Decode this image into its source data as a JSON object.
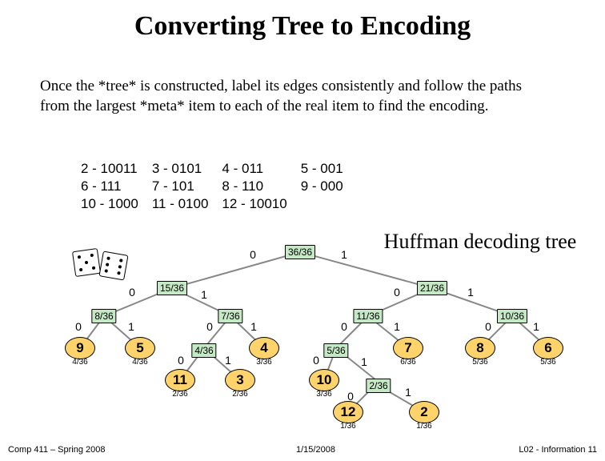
{
  "title": "Converting Tree to Encoding",
  "body": "Once the *tree* is constructed, label its edges consistently and follow the paths from the largest *meta* item to each of the real item to find the encoding.",
  "codes": {
    "r1": [
      "2 - 10011",
      "3 - 0101",
      "4 - 011",
      "5 - 001"
    ],
    "r2": [
      "6 - 111",
      "7 - 101",
      "8 - 110",
      "9 - 000"
    ],
    "r3": [
      "10 - 1000",
      "11 - 0100",
      "12 - 10010",
      ""
    ]
  },
  "hlabel": "Huffman decoding tree",
  "footer": {
    "left": "Comp 411 – Spring 2008",
    "mid": "1/15/2008",
    "right": "L02 - Information   11"
  },
  "nodes": {
    "root": "36/36",
    "n15": "15/36",
    "n21": "21/36",
    "n8": "8/36",
    "n7": "7/36",
    "n11": "11/36",
    "n10": "10/36",
    "n4": "4/36",
    "n5i": "5/36",
    "n2i": "2/36"
  },
  "leaves": {
    "l9": {
      "sym": "9",
      "p": "4/36"
    },
    "l5": {
      "sym": "5",
      "p": "4/36"
    },
    "l4": {
      "sym": "4",
      "p": "3/36"
    },
    "l11": {
      "sym": "11",
      "p": "2/36"
    },
    "l3": {
      "sym": "3",
      "p": "2/36"
    },
    "l7": {
      "sym": "7",
      "p": "6/36"
    },
    "l10": {
      "sym": "10",
      "p": "3/36"
    },
    "l12": {
      "sym": "12",
      "p": "1/36"
    },
    "l2": {
      "sym": "2",
      "p": "1/36"
    },
    "l8": {
      "sym": "8",
      "p": "5/36"
    },
    "l6": {
      "sym": "6",
      "p": "5/36"
    }
  },
  "edge": {
    "zero": "0",
    "one": "1"
  },
  "chart_data": {
    "type": "tree",
    "title": "Huffman decoding tree",
    "edge_labels": {
      "left": 0,
      "right": 1
    },
    "root": {
      "prob": "36/36",
      "0": {
        "prob": "15/36",
        "0": {
          "prob": "8/36",
          "0": {
            "symbol": 9,
            "prob": "4/36"
          },
          "1": {
            "symbol": 5,
            "prob": "4/36"
          }
        },
        "1": {
          "prob": "7/36",
          "0": {
            "prob": "4/36",
            "0": {
              "symbol": 11,
              "prob": "2/36"
            },
            "1": {
              "symbol": 3,
              "prob": "2/36"
            }
          },
          "1": {
            "symbol": 4,
            "prob": "3/36"
          }
        }
      },
      "1": {
        "prob": "21/36",
        "0": {
          "prob": "11/36",
          "0": {
            "prob": "5/36",
            "0": {
              "symbol": 10,
              "prob": "3/36",
              "0": {
                "prob": "2/36",
                "0": {
                  "symbol": 12,
                  "prob": "1/36"
                },
                "1": {
                  "symbol": 2,
                  "prob": "1/36"
                }
              }
            }
          },
          "1": {
            "symbol": 7,
            "prob": "6/36"
          }
        },
        "1": {
          "prob": "10/36",
          "0": {
            "symbol": 8,
            "prob": "5/36"
          },
          "1": {
            "symbol": 6,
            "prob": "5/36"
          }
        }
      }
    },
    "encodings": {
      "2": "10011",
      "3": "0101",
      "4": "011",
      "5": "001",
      "6": "111",
      "7": "101",
      "8": "110",
      "9": "000",
      "10": "1000",
      "11": "0100",
      "12": "10010"
    }
  }
}
